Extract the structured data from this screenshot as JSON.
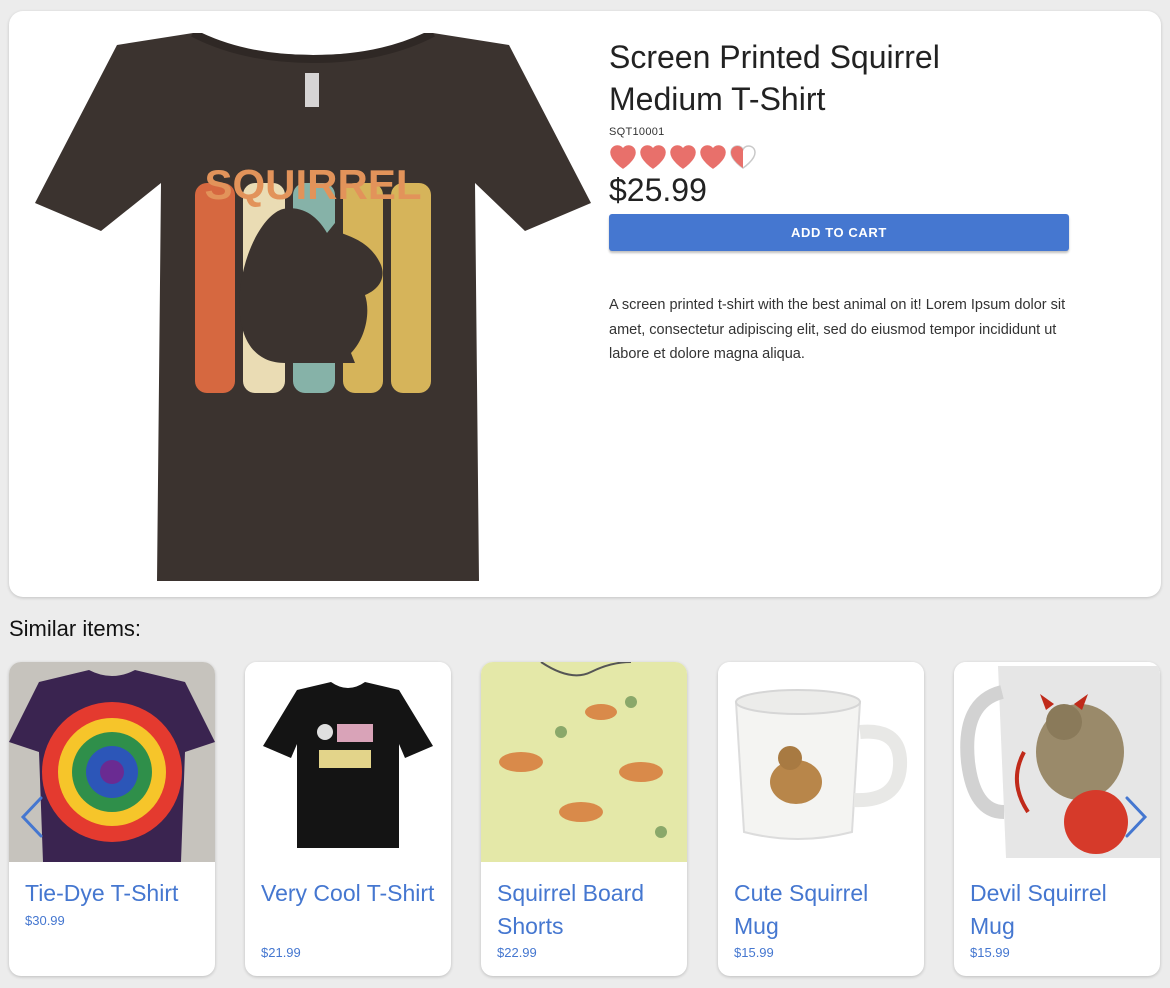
{
  "product": {
    "title_line1": "Screen Printed Squirrel",
    "title_line2": "Medium T-Shirt",
    "sku": "SQT10001",
    "rating": 4.5,
    "price": "$25.99",
    "add_to_cart_label": "ADD TO CART",
    "description": "A screen printed t-shirt with the best animal on it! Lorem Ipsum dolor sit amet, consectetur adipiscing elit, sed do eiusmod tempor incididunt ut labore et dolore magna aliqua.",
    "shirt_print_text": "SQUIRREL"
  },
  "similar": {
    "heading": "Similar items:",
    "items": [
      {
        "name": "Tie-Dye T-Shirt",
        "price": "$30.99"
      },
      {
        "name": "Very Cool T-Shirt",
        "price": "$21.99"
      },
      {
        "name": "Squirrel Board Shorts",
        "price": "$22.99"
      },
      {
        "name": "Cute Squirrel Mug",
        "price": "$15.99"
      },
      {
        "name": "Devil Squirrel Mug",
        "price": "$15.99"
      }
    ],
    "icons": {
      "prev": "chevron-left-icon",
      "next": "chevron-right-icon",
      "rating": "heart-icon"
    }
  },
  "colors": {
    "accent": "#4577d0",
    "heart": "#e8706b",
    "shirt": "#3b332f"
  }
}
